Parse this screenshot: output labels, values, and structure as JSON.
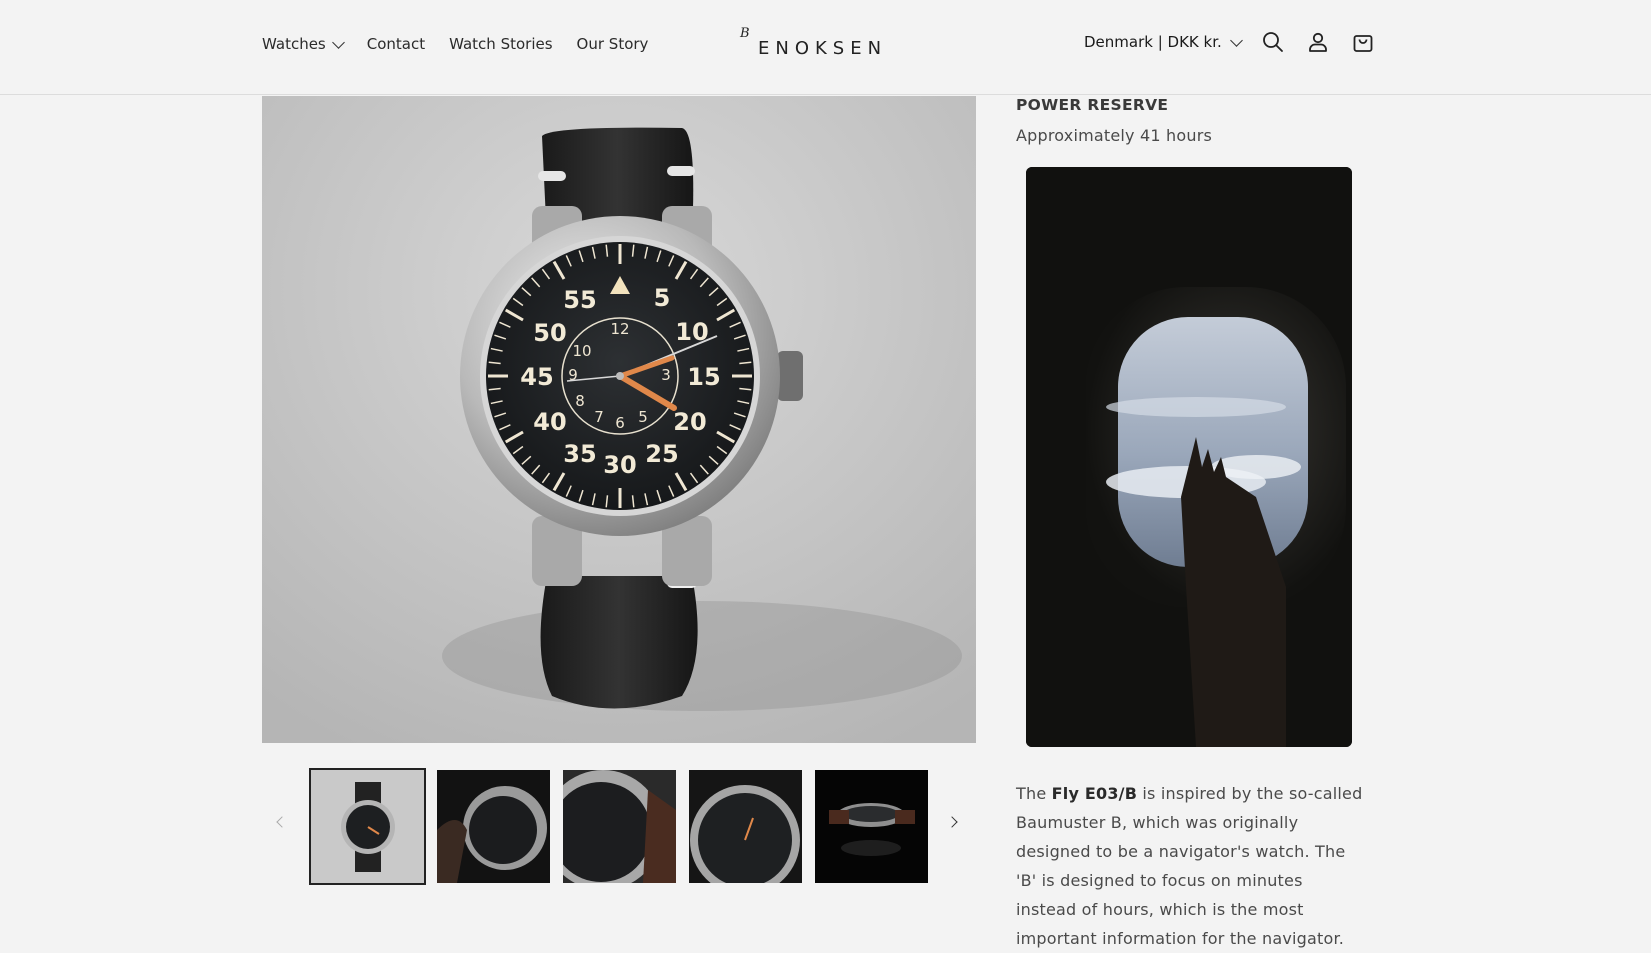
{
  "nav": {
    "items": [
      {
        "label": "Watches",
        "has_dropdown": true
      },
      {
        "label": "Contact"
      },
      {
        "label": "Watch Stories"
      },
      {
        "label": "Our Story"
      }
    ]
  },
  "logo": {
    "text": "ENOKSEN",
    "mark": "B"
  },
  "header": {
    "country_selector": "Denmark | DKK kr.",
    "icons": [
      "search-icon",
      "account-icon",
      "cart-icon"
    ]
  },
  "product": {
    "spec_title": "POWER RESERVE",
    "spec_value": "Approximately 41 hours",
    "desc_prefix": "The ",
    "desc_model": "Fly E03/B",
    "desc_rest": " is inspired by the so-called Baumuster B, which was originally designed to be a navigator's watch. The 'B' is designed to focus on minutes instead of hours, which is the most important information for the navigator.",
    "thumbnail_count": 5,
    "selected_thumbnail": 1
  },
  "colors": {
    "background": "#f3f3f3",
    "text": "#121212",
    "accent_orange": "#e0884a"
  }
}
